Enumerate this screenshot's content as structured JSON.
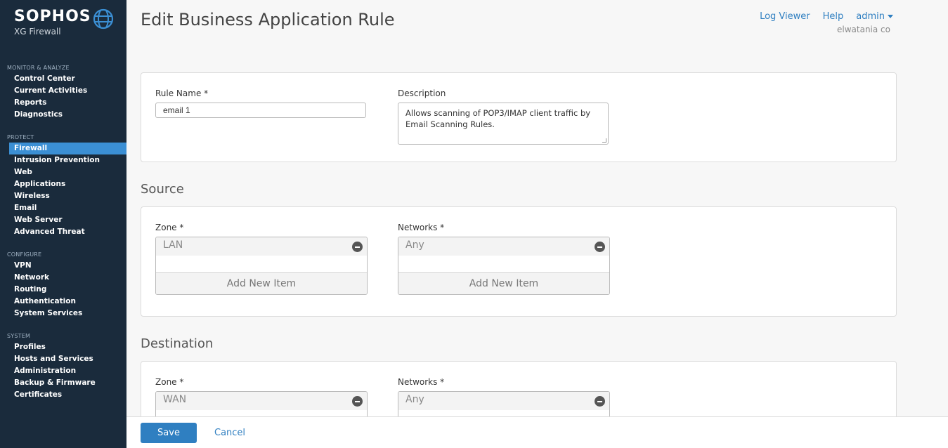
{
  "brand": {
    "name": "SOPHOS",
    "product": "XG Firewall",
    "logo_icon": "globe-icon"
  },
  "sidebar": {
    "sections": [
      {
        "heading": "MONITOR & ANALYZE",
        "items": [
          "Control Center",
          "Current Activities",
          "Reports",
          "Diagnostics"
        ]
      },
      {
        "heading": "PROTECT",
        "items": [
          "Firewall",
          "Intrusion Prevention",
          "Web",
          "Applications",
          "Wireless",
          "Email",
          "Web Server",
          "Advanced Threat"
        ]
      },
      {
        "heading": "CONFIGURE",
        "items": [
          "VPN",
          "Network",
          "Routing",
          "Authentication",
          "System Services"
        ]
      },
      {
        "heading": "SYSTEM",
        "items": [
          "Profiles",
          "Hosts and Services",
          "Administration",
          "Backup & Firmware",
          "Certificates"
        ]
      }
    ],
    "active_item": "Firewall"
  },
  "header": {
    "title": "Edit Business Application Rule",
    "log_viewer": "Log Viewer",
    "help": "Help",
    "user": "admin",
    "org": "elwatania co"
  },
  "general": {
    "rule_name_label": "Rule Name *",
    "rule_name_value": "email 1",
    "description_label": "Description",
    "description_value": "Allows scanning of POP3/IMAP client traffic by Email Scanning Rules."
  },
  "source": {
    "title": "Source",
    "zone_label": "Zone *",
    "zone_item": "LAN",
    "networks_label": "Networks *",
    "networks_item": "Any",
    "add_new": "Add New Item"
  },
  "destination": {
    "title": "Destination",
    "zone_label": "Zone *",
    "zone_item": "WAN",
    "networks_label": "Networks *",
    "networks_item": "Any"
  },
  "footer": {
    "save": "Save",
    "cancel": "Cancel"
  },
  "colors": {
    "sidebar_bg": "#1a2b3c",
    "accent": "#2f7fc1",
    "active_nav": "#3b8fd4"
  }
}
